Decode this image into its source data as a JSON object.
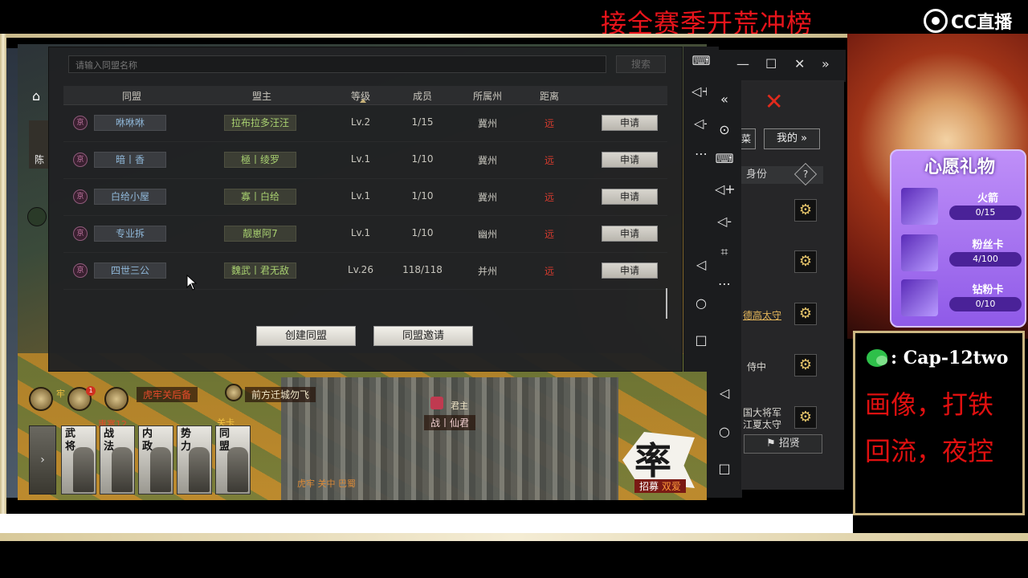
{
  "stream": {
    "banner_title": "接全赛季开荒冲榜",
    "platform_logo": "CC直播"
  },
  "alliance_dialog": {
    "search_placeholder": "请输入同盟名称",
    "search_button": "搜索",
    "columns": [
      "同盟",
      "盟主",
      "等级",
      "成员",
      "所属州",
      "距离"
    ],
    "rows": [
      {
        "rank": "京",
        "name": "咻咻咻",
        "leader": "拉布拉多汪汪",
        "level": "Lv.2",
        "members": "1/15",
        "state": "冀州",
        "distance": "远",
        "action": "申请"
      },
      {
        "rank": "京",
        "name": "暗丨香",
        "leader": "極丨绫罗",
        "level": "Lv.1",
        "members": "1/10",
        "state": "冀州",
        "distance": "远",
        "action": "申请"
      },
      {
        "rank": "京",
        "name": "白给小屋",
        "leader": "寡丨白给",
        "level": "Lv.1",
        "members": "1/10",
        "state": "冀州",
        "distance": "远",
        "action": "申请"
      },
      {
        "rank": "京",
        "name": "专业拆",
        "leader": "靓崽阿7",
        "level": "Lv.1",
        "members": "1/10",
        "state": "幽州",
        "distance": "远",
        "action": "申请"
      },
      {
        "rank": "京",
        "name": "四世三公",
        "leader": "魏武丨君无敌",
        "level": "Lv.26",
        "members": "118/118",
        "state": "并州",
        "distance": "远",
        "action": "申请"
      }
    ],
    "create_button": "创建同盟",
    "invite_button": "同盟邀请"
  },
  "hud": {
    "pass_label": "虎牢关后备",
    "move_label": "前方迁城勿飞",
    "notify_count": "1",
    "left_label": "牢",
    "yellow_label_1": "惠寨12",
    "yellow_label_2": "关卡",
    "player_tag": "君主",
    "player_name": "战丨仙君",
    "tabs": [
      "武将",
      "战法",
      "内政",
      "势力",
      "同盟"
    ],
    "bottom_text": "虎牢  关中  巴蜀",
    "side_label": "陈",
    "recruit_char": "率",
    "recruit_tag_left": "招募",
    "recruit_tag_right": "双爱"
  },
  "side_window": {
    "mine_button": "我的 »",
    "partial_button": "菜",
    "identity_header": "身份",
    "help_icon": "?",
    "roles": [
      "",
      "",
      "德高太守",
      "侍中",
      "国大将军",
      "江夏太守"
    ],
    "recruit_button": "招贤"
  },
  "wish_gifts": {
    "title": "心愿礼物",
    "items": [
      {
        "name": "火箭",
        "progress": "0/15",
        "fraction": 0.0
      },
      {
        "name": "粉丝卡",
        "progress": "4/100",
        "fraction": 0.04
      },
      {
        "name": "钻粉卡",
        "progress": "0/10",
        "fraction": 0.0
      }
    ]
  },
  "contact": {
    "wechat": ": Cap-12two",
    "tags_line1": "画像，打铁",
    "tags_line2": "回流，夜控"
  },
  "colors": {
    "banner_red": "#e8141b",
    "distance_red": "#d83b2e",
    "leader_green": "#a8d070",
    "name_blue": "#8fb7d8",
    "wish_purple": "#8f5ae8"
  }
}
